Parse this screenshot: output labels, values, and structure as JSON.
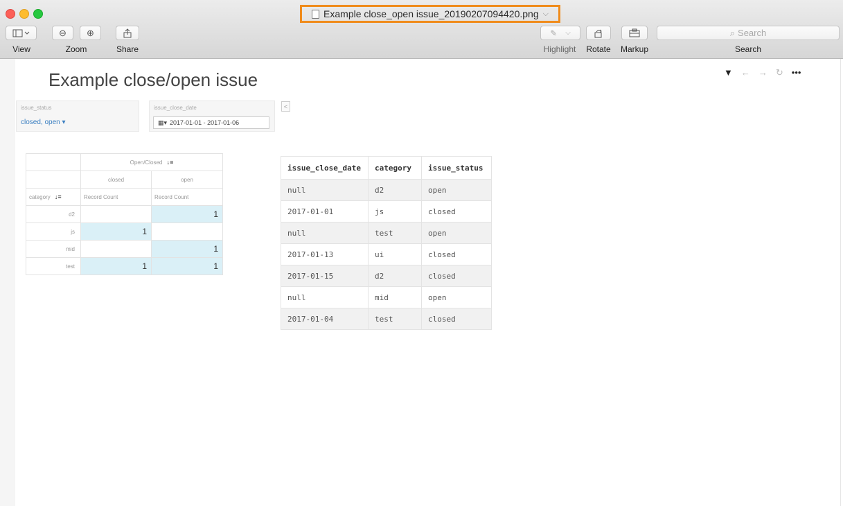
{
  "window": {
    "title": "Example close_open issue_20190207094420.png",
    "toolbar": {
      "view_label": "View",
      "zoom_label": "Zoom",
      "share_label": "Share",
      "highlight_label": "Highlight",
      "rotate_label": "Rotate",
      "markup_label": "Markup",
      "search_placeholder": "Search",
      "search_label": "Search"
    }
  },
  "dashboard": {
    "title": "Example close/open issue",
    "filters": {
      "status_label": "issue_status",
      "status_value": "closed, open ▾",
      "date_label": "issue_close_date",
      "date_value": "2017-01-01 - 2017-01-06"
    },
    "pivot": {
      "header": "Open/Closed",
      "columns": [
        "closed",
        "open"
      ],
      "row_label": "category",
      "measure": "Record Count",
      "rows": [
        {
          "category": "d2",
          "closed": "",
          "open": "1"
        },
        {
          "category": "js",
          "closed": "1",
          "open": ""
        },
        {
          "category": "mid",
          "closed": "",
          "open": "1"
        },
        {
          "category": "test",
          "closed": "1",
          "open": "1"
        }
      ]
    },
    "table": {
      "headers": [
        "issue_close_date",
        "category",
        "issue_status"
      ],
      "rows": [
        [
          "null",
          "d2",
          "open"
        ],
        [
          "2017-01-01",
          "js",
          "closed"
        ],
        [
          "null",
          "test",
          "open"
        ],
        [
          "2017-01-13",
          "ui",
          "closed"
        ],
        [
          "2017-01-15",
          "d2",
          "closed"
        ],
        [
          "null",
          "mid",
          "open"
        ],
        [
          "2017-01-04",
          "test",
          "closed"
        ]
      ]
    }
  }
}
